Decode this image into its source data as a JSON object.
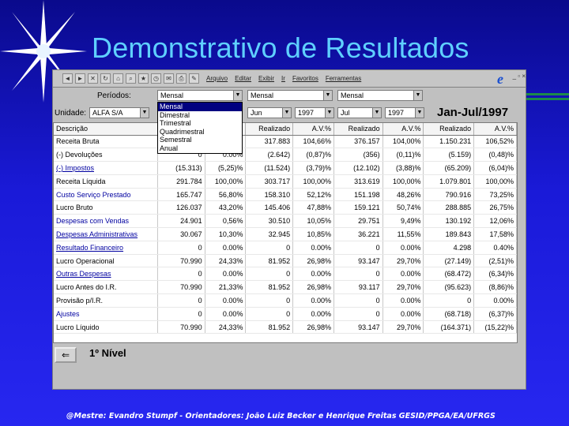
{
  "slide": {
    "title": "Demonstrativo de Resultados",
    "credits": "@Mestre: Evandro Stumpf - Orientadores: João Luiz Becker e Henrique Freitas GESID/PPGA/EA/UFRGS"
  },
  "toolbar": {
    "menus": [
      "Arquivo",
      "Editar",
      "Exibir",
      "Ir",
      "Favoritos",
      "Ferramentas"
    ],
    "window_controls": "_ ▫ ×"
  },
  "filters": {
    "periodos_label": "Períodos:",
    "periodos_value": "Mensal",
    "unidade_label": "Unidade:",
    "unidade_value": "ALFA S/A",
    "combo_top_2": "Mensal",
    "combo_top_3": "Mensal",
    "month_1": "Jun",
    "year_1": "1997",
    "month_2": "Jul",
    "year_2": "1997",
    "period_title": "Jan-Jul/1997"
  },
  "dropdown": {
    "options": [
      "Mensal",
      "Dimestral",
      "Trimestral",
      "Quadrimestral",
      "Semestral",
      "Anual"
    ],
    "selected": "Mensal"
  },
  "grid": {
    "headers": [
      "Descrição",
      "",
      "",
      "Realizado",
      "A.V.%",
      "Realizado",
      "A.V.%",
      "Realizado",
      "A.V.%"
    ],
    "rows": [
      {
        "desc": "Receita Bruta",
        "style": "plain",
        "c1": "",
        "c2": "",
        "c3": "317.883",
        "c4": "104,66%",
        "c5": "376.157",
        "c6": "104,00%",
        "c7": "1.150.231",
        "c8": "106,52%"
      },
      {
        "desc": "(-) Devoluções",
        "style": "plain",
        "c1": "0",
        "c2": "0.00%",
        "c3": "(2.642)",
        "c4": "(0,87)%",
        "c5": "(356)",
        "c6": "(0,11)%",
        "c7": "(5.159)",
        "c8": "(0,48)%"
      },
      {
        "desc": "(-) Impostos",
        "style": "link",
        "c1": "(15.313)",
        "c2": "(5,25)%",
        "c3": "(11.524)",
        "c4": "(3,79)%",
        "c5": "(12.102)",
        "c6": "(3,88)%",
        "c7": "(65.209)",
        "c8": "(6,04)%"
      },
      {
        "desc": "Receita Líquida",
        "style": "plain",
        "c1": "291.784",
        "c2": "100,00%",
        "c3": "303.717",
        "c4": "100,00%",
        "c5": "313.619",
        "c6": "100,00%",
        "c7": "1.079.801",
        "c8": "100,00%"
      },
      {
        "desc": "Custo Serviço Prestado",
        "style": "link-plain",
        "c1": "165.747",
        "c2": "56,80%",
        "c3": "158.310",
        "c4": "52,12%",
        "c5": "151.198",
        "c6": "48,26%",
        "c7": "790.916",
        "c8": "73,25%"
      },
      {
        "desc": "Lucro Bruto",
        "style": "plain",
        "c1": "126.037",
        "c2": "43,20%",
        "c3": "145.406",
        "c4": "47,88%",
        "c5": "159.121",
        "c6": "50,74%",
        "c7": "288.885",
        "c8": "26,75%"
      },
      {
        "desc": "Despesas com Vendas",
        "style": "link-plain",
        "c1": "24.901",
        "c2": "0,56%",
        "c3": "30.510",
        "c4": "10,05%",
        "c5": "29.751",
        "c6": "9,49%",
        "c7": "130.192",
        "c8": "12,06%"
      },
      {
        "desc": "Despesas Administrativas",
        "style": "link",
        "c1": "30.067",
        "c2": "10,30%",
        "c3": "32.945",
        "c4": "10,85%",
        "c5": "36.221",
        "c6": "11,55%",
        "c7": "189.843",
        "c8": "17,58%"
      },
      {
        "desc": "Resultado Financeiro",
        "style": "link",
        "c1": "0",
        "c2": "0.00%",
        "c3": "0",
        "c4": "0.00%",
        "c5": "0",
        "c6": "0.00%",
        "c7": "4.298",
        "c8": "0.40%"
      },
      {
        "desc": "Lucro Operacional",
        "style": "plain",
        "c1": "70.990",
        "c2": "24,33%",
        "c3": "81.952",
        "c4": "26,98%",
        "c5": "93.147",
        "c6": "29,70%",
        "c7": "(27.149)",
        "c8": "(2,51)%"
      },
      {
        "desc": "Outras Despesas",
        "style": "link",
        "c1": "0",
        "c2": "0.00%",
        "c3": "0",
        "c4": "0.00%",
        "c5": "0",
        "c6": "0.00%",
        "c7": "(68.472)",
        "c8": "(6,34)%"
      },
      {
        "desc": "Lucro Antes do I.R.",
        "style": "plain",
        "c1": "70.990",
        "c2": "21,33%",
        "c3": "81.952",
        "c4": "26,98%",
        "c5": "93.117",
        "c6": "29,70%",
        "c7": "(95.623)",
        "c8": "(8,86)%"
      },
      {
        "desc": "Provisão p/I.R.",
        "style": "plain",
        "c1": "0",
        "c2": "0.00%",
        "c3": "0",
        "c4": "0.00%",
        "c5": "0",
        "c6": "0.00%",
        "c7": "0",
        "c8": "0.00%"
      },
      {
        "desc": "Ajustes",
        "style": "link-plain",
        "c1": "0",
        "c2": "0.00%",
        "c3": "0",
        "c4": "0.00%",
        "c5": "0",
        "c6": "0.00%",
        "c7": "(68.718)",
        "c8": "(6,37)%"
      },
      {
        "desc": "Lucro Líquido",
        "style": "plain",
        "c1": "70.990",
        "c2": "24,33%",
        "c3": "81.952",
        "c4": "26,98%",
        "c5": "93.147",
        "c6": "29,70%",
        "c7": "(164.371)",
        "c8": "(15,22)%"
      }
    ]
  },
  "footer": {
    "back_icon": "arrow-left-icon",
    "level_label": "1º Nível"
  },
  "colors": {
    "background": "#1a1ad8",
    "title": "#5fd0ff",
    "accent_stripe": "#1c8a4a",
    "link": "#0000a0"
  }
}
